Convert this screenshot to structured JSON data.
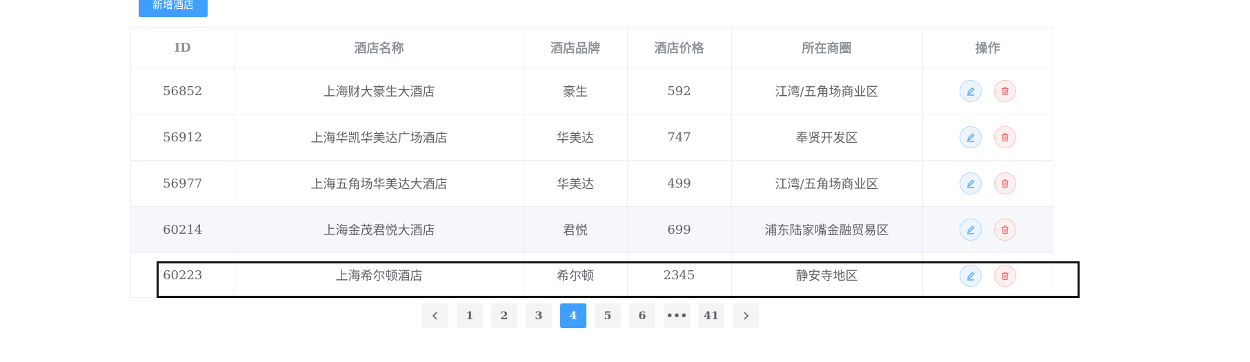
{
  "toolbar": {
    "add_label": "新增酒店"
  },
  "table": {
    "headers": [
      "ID",
      "酒店名称",
      "酒店品牌",
      "酒店价格",
      "所在商圈",
      "操作"
    ],
    "rows": [
      {
        "id": "56852",
        "name": "上海财大豪生大酒店",
        "brand": "豪生",
        "price": "592",
        "area": "江湾/五角场商业区"
      },
      {
        "id": "56912",
        "name": "上海华凯华美达广场酒店",
        "brand": "华美达",
        "price": "747",
        "area": "奉贤开发区"
      },
      {
        "id": "56977",
        "name": "上海五角场华美达大酒店",
        "brand": "华美达",
        "price": "499",
        "area": "江湾/五角场商业区"
      },
      {
        "id": "60214",
        "name": "上海金茂君悦大酒店",
        "brand": "君悦",
        "price": "699",
        "area": "浦东陆家嘴金融贸易区"
      },
      {
        "id": "60223",
        "name": "上海希尔顿酒店",
        "brand": "希尔顿",
        "price": "2345",
        "area": "静安寺地区"
      }
    ]
  },
  "pagination": {
    "pages": [
      "1",
      "2",
      "3",
      "4",
      "5",
      "6",
      "•••",
      "41"
    ],
    "current": "4"
  },
  "icons": {
    "edit": "edit-icon",
    "delete": "delete-icon",
    "prev": "chevron-left-icon",
    "next": "chevron-right-icon"
  },
  "colors": {
    "primary": "#409eff",
    "danger": "#f56c6c",
    "header_text": "#909399",
    "hover_row": "#f5f7fa",
    "highlight_border": "#111111"
  }
}
